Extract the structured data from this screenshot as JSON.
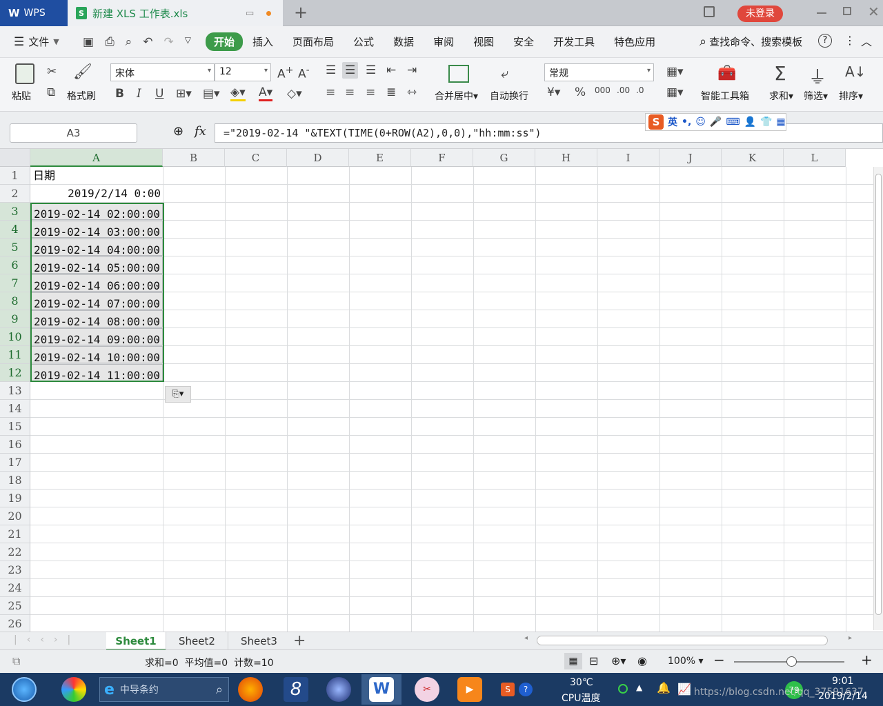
{
  "titlebar": {
    "app_tab": "WPS",
    "file_tab": "新建 XLS 工作表.xls",
    "add_tab": "+",
    "login_button": "未登录"
  },
  "menubar": {
    "file_menu": "文件",
    "tabs": [
      "开始",
      "插入",
      "页面布局",
      "公式",
      "数据",
      "审阅",
      "视图",
      "安全",
      "开发工具",
      "特色应用"
    ],
    "active_tab": "开始",
    "search": "查找命令、搜索模板"
  },
  "ribbon": {
    "paste": "粘贴",
    "format_painter": "格式刷",
    "font_name": "宋体",
    "font_size": "12",
    "merge_center": "合并居中",
    "wrap_text": "自动换行",
    "number_format": "常规",
    "smart_toolbox": "智能工具箱",
    "sum": "求和",
    "filter": "筛选",
    "sort": "排序"
  },
  "formula_bar": {
    "name_box": "A3",
    "fx": "fx",
    "formula": "=\"2019-02-14 \"&TEXT(TIME(0+ROW(A2),0,0),\"hh:mm:ss\")"
  },
  "ime": {
    "mode": "英"
  },
  "sheet": {
    "columns": [
      "A",
      "B",
      "C",
      "D",
      "E",
      "F",
      "G",
      "H",
      "I",
      "J",
      "K",
      "L"
    ],
    "rows": [
      "1",
      "2",
      "3",
      "4",
      "5",
      "6",
      "7",
      "8",
      "9",
      "10",
      "11",
      "12",
      "13",
      "14",
      "15",
      "16",
      "17",
      "18",
      "19",
      "20",
      "21",
      "22",
      "23",
      "24",
      "25",
      "26"
    ],
    "cells_a": [
      {
        "row": 1,
        "text": "日期",
        "align": "left"
      },
      {
        "row": 2,
        "text": "2019/2/14 0:00",
        "align": "right"
      },
      {
        "row": 3,
        "text": "2019-02-14 02:00:00",
        "align": "left"
      },
      {
        "row": 4,
        "text": "2019-02-14 03:00:00",
        "align": "left"
      },
      {
        "row": 5,
        "text": "2019-02-14 04:00:00",
        "align": "left"
      },
      {
        "row": 6,
        "text": "2019-02-14 05:00:00",
        "align": "left"
      },
      {
        "row": 7,
        "text": "2019-02-14 06:00:00",
        "align": "left"
      },
      {
        "row": 8,
        "text": "2019-02-14 07:00:00",
        "align": "left"
      },
      {
        "row": 9,
        "text": "2019-02-14 08:00:00",
        "align": "left"
      },
      {
        "row": 10,
        "text": "2019-02-14 09:00:00",
        "align": "left"
      },
      {
        "row": 11,
        "text": "2019-02-14 10:00:00",
        "align": "left"
      },
      {
        "row": 12,
        "text": "2019-02-14 11:00:00",
        "align": "left"
      }
    ]
  },
  "sheet_tabs": [
    "Sheet1",
    "Sheet2",
    "Sheet3"
  ],
  "active_sheet": "Sheet1",
  "statusbar": {
    "summary": "求和=0  平均值=0  计数=10",
    "zoom": "100%"
  },
  "taskbar": {
    "search_text": "中导条约",
    "temperature": "30℃",
    "temp_label": "CPU温度",
    "badge": "79",
    "time": "9:01",
    "date": "2019/2/14",
    "watermark": "https://blog.csdn.net/qq_37591637"
  },
  "colors": {
    "accent": "#2c8a3c",
    "wps_blue": "#1f4ea1",
    "login_red": "#e0473c"
  }
}
